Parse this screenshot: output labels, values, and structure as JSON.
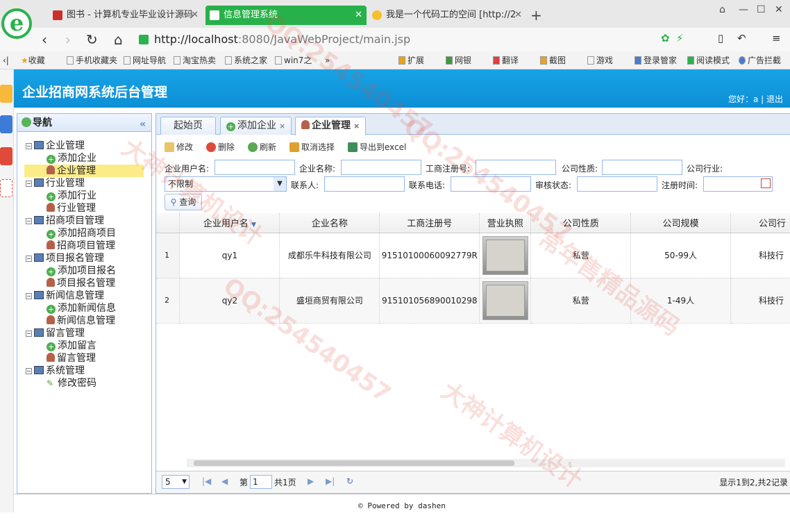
{
  "browser": {
    "tabs": [
      {
        "label": "图书 - 计算机专业毕业设计源码"
      },
      {
        "label": "信息管理系统"
      },
      {
        "label": "我是一个代码工的空间 [http://2"
      }
    ],
    "new_tab": "+",
    "url_host": "http://localhost",
    "url_path": ":8080/JavaWebProject/main.jsp",
    "bookmarks": [
      "收藏",
      "手机收藏夹",
      "网址导航",
      "淘宝热卖",
      "系统之家",
      "win7之",
      "»",
      "扩展",
      "网银",
      "翻译",
      "截图",
      "游戏",
      "登录管家",
      "阅读模式",
      "广告拦截"
    ]
  },
  "app": {
    "title": "企业招商网系统后台管理",
    "greeting": "您好：a",
    "logout": "退出"
  },
  "nav": {
    "title": "导航",
    "collapse": "«",
    "groups": [
      {
        "label": "企业管理",
        "items": [
          "添加企业",
          "企业管理"
        ]
      },
      {
        "label": "行业管理",
        "items": [
          "添加行业",
          "行业管理"
        ]
      },
      {
        "label": "招商项目管理",
        "items": [
          "添加招商项目",
          "招商项目管理"
        ]
      },
      {
        "label": "项目报名管理",
        "items": [
          "添加项目报名",
          "项目报名管理"
        ]
      },
      {
        "label": "新闻信息管理",
        "items": [
          "添加新闻信息",
          "新闻信息管理"
        ]
      },
      {
        "label": "留言管理",
        "items": [
          "添加留言",
          "留言管理"
        ]
      },
      {
        "label": "系统管理",
        "items": [
          "修改密码"
        ]
      }
    ]
  },
  "main_tabs": [
    {
      "label": "起始页"
    },
    {
      "label": "添加企业",
      "close": "×"
    },
    {
      "label": "企业管理",
      "close": "×"
    }
  ],
  "toolbar": {
    "edit": "修改",
    "delete": "删除",
    "refresh": "刷新",
    "cancel_select": "取消选择",
    "export": "导出到excel"
  },
  "filters": {
    "user_name": "企业用户名:",
    "company_name": "企业名称:",
    "reg_no": "工商注册号:",
    "nature": "公司性质:",
    "industry": "公司行业:",
    "industry_value": "不限制",
    "contact": "联系人:",
    "phone": "联系电话:",
    "audit": "审核状态:",
    "reg_time": "注册时间:",
    "search": "查询"
  },
  "grid": {
    "columns": [
      "企业用户名",
      "企业名称",
      "工商注册号",
      "营业执照",
      "公司性质",
      "公司规模",
      "公司行"
    ],
    "rows": [
      {
        "num": "1",
        "user": "qy1",
        "name": "成都乐牛科技有限公司",
        "reg": "91510100060092779R",
        "nature": "私营",
        "scale": "50-99人",
        "industry": "科技行"
      },
      {
        "num": "2",
        "user": "qy2",
        "name": "盛垣商贸有限公司",
        "reg": "915101056890010298",
        "nature": "私营",
        "scale": "1-49人",
        "industry": "科技行"
      }
    ]
  },
  "pager": {
    "page_size": "5",
    "page_prefix": "第",
    "page_value": "1",
    "page_total": "共1页",
    "summary": "显示1到2,共2记录"
  },
  "footer": "© Powered by dashen",
  "colors": {
    "banner": "#0c8fd6",
    "accent": "#28b14a"
  }
}
